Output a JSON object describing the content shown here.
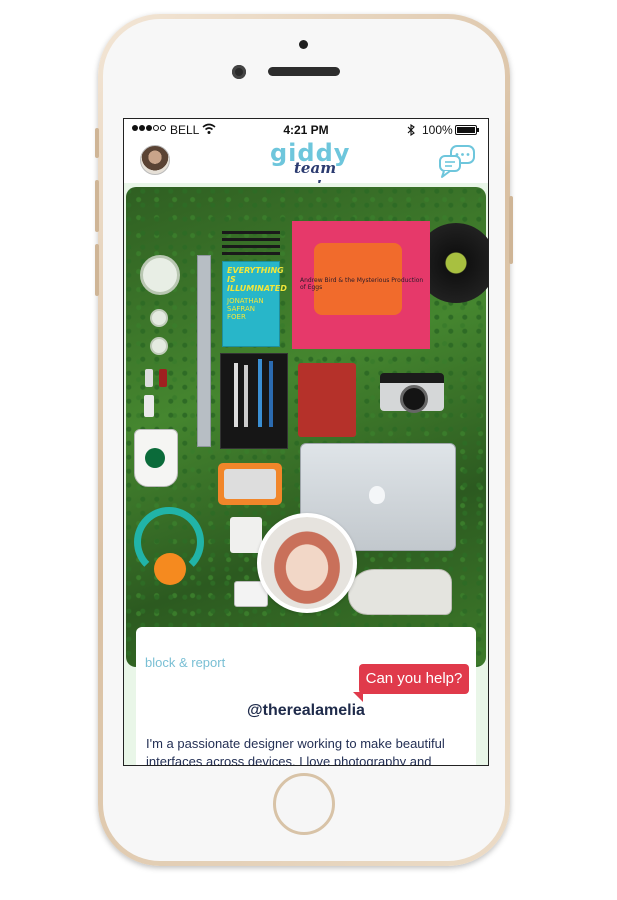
{
  "status": {
    "carrier": "BELL",
    "time": "4:21 PM",
    "battery": "100%"
  },
  "header": {
    "logo_main": "giddy",
    "logo_sub": "team up!"
  },
  "profile": {
    "block_report": "block & report",
    "help_label": "Can you help?",
    "username": "@therealamelia",
    "bio": "I'm a passionate designer working to make beautiful interfaces across devices. I love photography and"
  },
  "photo_items": {
    "book_title": "EVERYTHING IS ILLUMINATED",
    "book_author": "JONATHAN SAFRAN FOER",
    "record_label": "Andrew Bird & the Mysterious Production of Eggs"
  },
  "colors": {
    "accent_blue": "#6ec6dc",
    "navy": "#2b3b70",
    "help_red": "#e03a4b"
  },
  "icons": [
    "wifi-icon",
    "bluetooth-icon",
    "battery-icon",
    "chat-bubbles-icon",
    "avatar"
  ]
}
